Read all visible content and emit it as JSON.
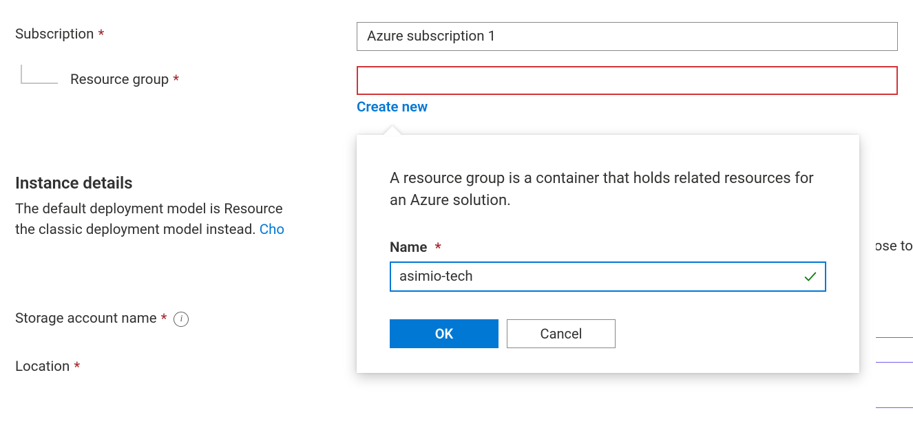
{
  "form": {
    "subscription": {
      "label": "Subscription",
      "value": "Azure subscription 1"
    },
    "resource_group": {
      "label": "Resource group",
      "create_new": "Create new"
    },
    "instance_details": {
      "heading": "Instance details",
      "description_part1": "The default deployment model is Resource ",
      "description_part2": "the classic deployment model instead.  ",
      "description_link": "Cho",
      "right_edge_fragment": "ose to"
    },
    "storage_account": {
      "label": "Storage account name"
    },
    "location": {
      "label": "Location"
    }
  },
  "popover": {
    "description": "A resource group is a container that holds related resources for an Azure solution.",
    "name_label": "Name",
    "name_value": "asimio-tech",
    "ok": "OK",
    "cancel": "Cancel"
  }
}
